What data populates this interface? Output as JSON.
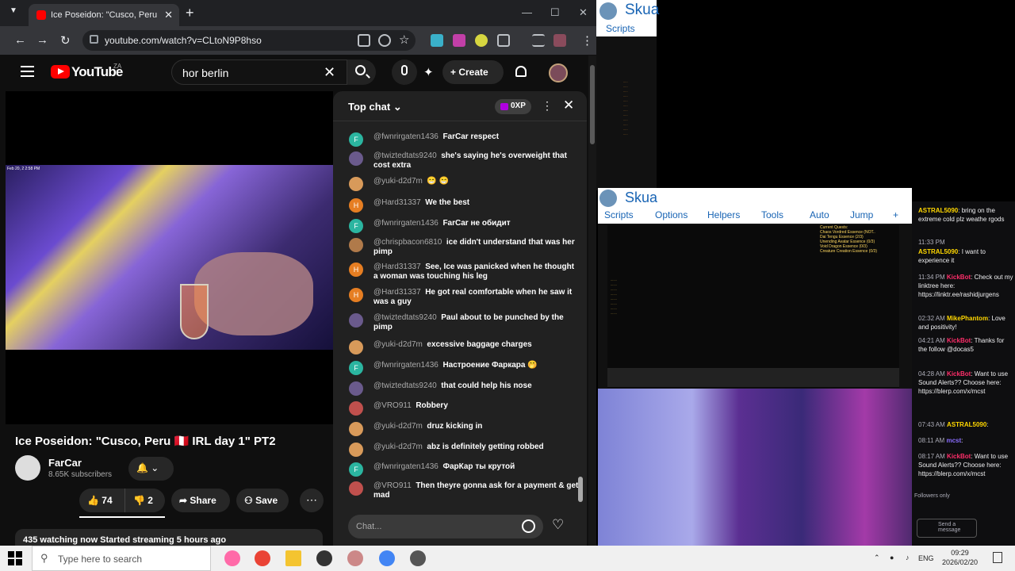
{
  "browser": {
    "tab_title": "Ice Poseidon: \"Cusco, Peru",
    "url": "youtube.com/watch?v=CLtoN9P8hso",
    "tab_list_icon": "chevron-down-icon",
    "new_tab_label": "+"
  },
  "youtube": {
    "logo_text": "YouTube",
    "region": "ZA",
    "search_value": "hor berlin",
    "create_label": "Create",
    "video": {
      "title": "Ice Poseidon: \"Cusco, Peru 🇵🇪 IRL day 1\" PT2",
      "channel": "FarCar",
      "subscribers": "8.65K subscribers",
      "likes": "74",
      "dislikes": "2",
      "share_label": "Share",
      "save_label": "Save",
      "description": "435 watching now  Started streaming 5 hours ago",
      "stamp": "Feb 20, 2 2:58 PM"
    },
    "chat": {
      "mode": "Top chat",
      "xp": "0XP",
      "input_placeholder": "Chat...",
      "messages": [
        {
          "author": "@fwnrirgaten1436",
          "text": "FarCar respect",
          "initial": "F",
          "color": "#2bb5a0"
        },
        {
          "author": "@twiztedtats9240",
          "text": "she's saying he's overweight that cost extra",
          "initial": "",
          "color": "#6a5a8c"
        },
        {
          "author": "@yuki-d2d7m",
          "text": "😁 😁",
          "initial": "",
          "color": "#d89a5a"
        },
        {
          "author": "@Hard31337",
          "text": "We the best",
          "initial": "H",
          "color": "#e67e22"
        },
        {
          "author": "@fwnrirgaten1436",
          "text": "FarCar не обидит",
          "initial": "F",
          "color": "#2bb5a0"
        },
        {
          "author": "@chrispbacon6810",
          "text": "ice didn't understand that was her pimp",
          "initial": "",
          "color": "#b07a4a"
        },
        {
          "author": "@Hard31337",
          "text": "See, Ice was panicked when he thought a woman was touching his leg",
          "initial": "H",
          "color": "#e67e22"
        },
        {
          "author": "@Hard31337",
          "text": "He got real comfortable when he saw it was a guy",
          "initial": "H",
          "color": "#e67e22"
        },
        {
          "author": "@twiztedtats9240",
          "text": "Paul about to be punched by the pimp",
          "initial": "",
          "color": "#6a5a8c"
        },
        {
          "author": "@yuki-d2d7m",
          "text": "excessive baggage charges",
          "initial": "",
          "color": "#d89a5a"
        },
        {
          "author": "@fwnrirgaten1436",
          "text": "Настроение Фаркара 🤭",
          "initial": "F",
          "color": "#2bb5a0"
        },
        {
          "author": "@twiztedtats9240",
          "text": "that could help his nose",
          "initial": "",
          "color": "#6a5a8c"
        },
        {
          "author": "@VRO911",
          "text": "Robbery",
          "initial": "",
          "color": "#c0504d"
        },
        {
          "author": "@yuki-d2d7m",
          "text": "druz kicking in",
          "initial": "",
          "color": "#d89a5a"
        },
        {
          "author": "@yuki-d2d7m",
          "text": "abz is definitely getting robbed",
          "initial": "",
          "color": "#d89a5a"
        },
        {
          "author": "@fwnrirgaten1436",
          "text": "ФарКар ты крутой",
          "initial": "F",
          "color": "#2bb5a0"
        },
        {
          "author": "@VRO911",
          "text": "Then theyre gonna ask for a payment & get mad",
          "initial": "",
          "color": "#c0504d"
        }
      ]
    }
  },
  "skua": {
    "title": "Skua",
    "window1_tab": "Scripts",
    "menu": [
      "Scripts",
      "Options",
      "Helpers",
      "Tools",
      "Auto",
      "Jump",
      "+"
    ],
    "quest_title": "Current Quests:",
    "quests": [
      "Chaos Vordred Essence (NOT..",
      "Dai Tengu Essence (2/3)",
      "Unending Avatar Essence (0/3)",
      "Void Dragon Essence (0/3)",
      "Creature Creation Essence (0/3)"
    ]
  },
  "twitch": {
    "messages": [
      {
        "time": "",
        "user": "ASTRAL5090",
        "text": ": bring on the extreme cold plz weathe rgods",
        "ucls": "u3"
      },
      {
        "time": "11:33 PM",
        "user": "",
        "text": "",
        "ucls": "u3"
      },
      {
        "time": "",
        "user": "ASTRAL5090",
        "text": ": I want to experience it",
        "ucls": "u3"
      },
      {
        "time": "11:34 PM",
        "user": "KickBot",
        "text": ": Check out my linktree here: https://linktr.ee/rashidjurgens",
        "ucls": "u2"
      },
      {
        "time": "02:32 AM",
        "user": "MikePhantom",
        "text": ": Love and positivity!",
        "ucls": "u3"
      },
      {
        "time": "04:21 AM",
        "user": "KickBot",
        "text": ": Thanks for the follow @docas5",
        "ucls": "u2"
      },
      {
        "time": "04:28 AM",
        "user": "KickBot",
        "text": ": Want to use Sound Alerts?? Choose here: https://blerp.com/x/mcst",
        "ucls": "u2"
      },
      {
        "time": "07:43 AM",
        "user": "ASTRAL5090",
        "text": ":",
        "ucls": "u3"
      },
      {
        "time": "08:11 AM",
        "user": "mcst",
        "text": ":",
        "ucls": "u4"
      },
      {
        "time": "08:17 AM",
        "user": "KickBot",
        "text": ": Want to use Sound Alerts?? Choose here: https://blerp.com/x/mcst",
        "ucls": "u2"
      }
    ],
    "followers_only": "Followers only",
    "send_placeholder": "Send a message"
  },
  "taskbar": {
    "search_placeholder": "Type here to search",
    "language": "ENG",
    "time": "09:29",
    "date": "2026/02/20"
  }
}
